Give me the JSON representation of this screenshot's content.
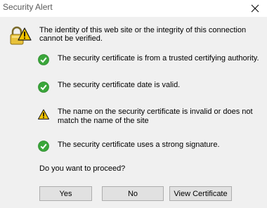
{
  "window": {
    "title": "Security Alert",
    "close_symbol": "✕"
  },
  "intro": {
    "icon": "padlock-warning-icon",
    "text": "The identity of this web site or the integrity of this connection cannot be verified."
  },
  "checks": [
    {
      "status": "ok",
      "icon": "green-check-icon",
      "text": "The security certificate is from a trusted certifying authority."
    },
    {
      "status": "ok",
      "icon": "green-check-icon",
      "text": "The security certificate date is valid."
    },
    {
      "status": "warning",
      "icon": "warning-triangle-icon",
      "text": "The name on the security certificate is invalid or does not match the name of the site"
    },
    {
      "status": "ok",
      "icon": "green-check-icon",
      "text": "The security certificate uses a strong signature."
    }
  ],
  "question": "Do you want to proceed?",
  "buttons": {
    "yes": "Yes",
    "no": "No",
    "view_certificate": "View Certificate"
  },
  "colors": {
    "check_green": "#3aa63a",
    "warning_yellow": "#f5c400",
    "dialog_bg": "#f0f0f0",
    "title_text": "#5a5a5a"
  }
}
